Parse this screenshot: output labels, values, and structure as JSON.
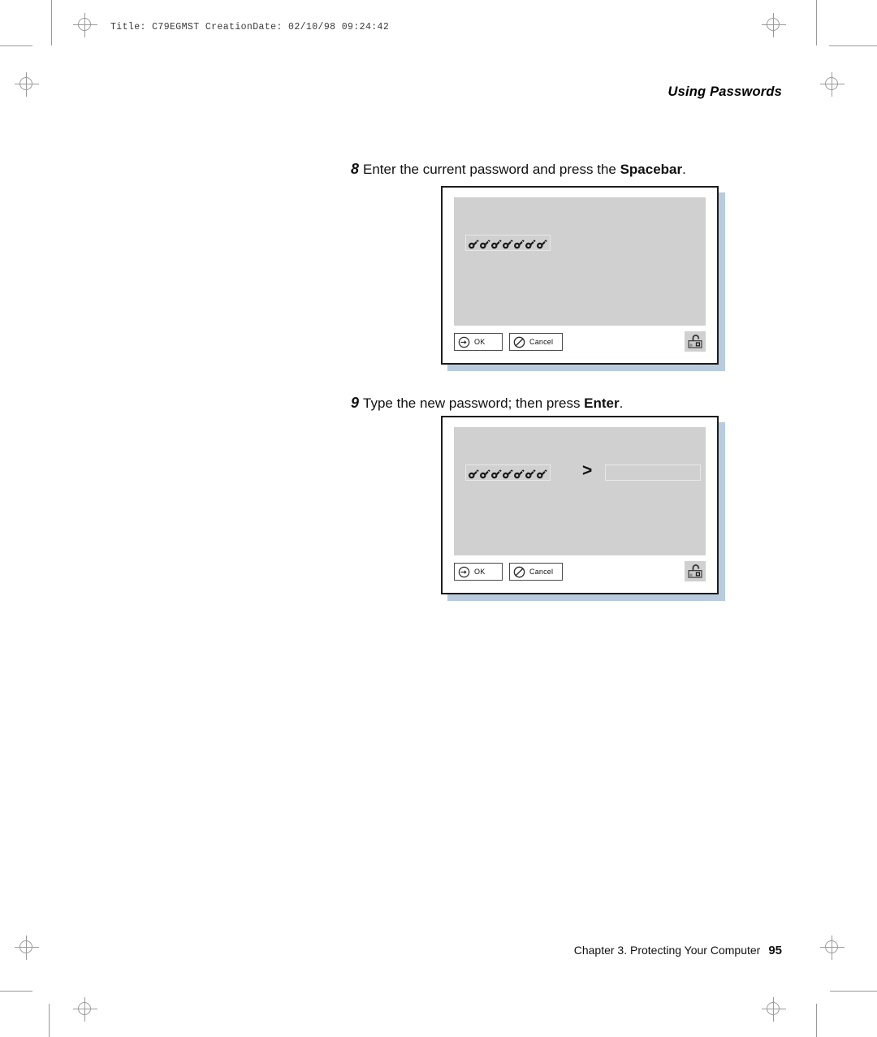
{
  "print_banner": "Title: C79EGMST CreationDate: 02/10/98 09:24:42",
  "page_header": "Using Passwords",
  "steps": [
    {
      "number": "8",
      "text_before": "Enter the current password and press the ",
      "emphasis": "Spacebar",
      "text_after": "."
    },
    {
      "number": "9",
      "text_before": "Type the new password; then press ",
      "emphasis": "Enter",
      "text_after": "."
    }
  ],
  "dialogs": [
    {
      "name": "current-password-dialog",
      "key_count": 7,
      "show_chevron": false,
      "show_entry_field": false,
      "entry_value": "",
      "ok_label": "OK",
      "cancel_label": "Cancel",
      "ok_icon": "arrow-right-circle-icon",
      "cancel_icon": "no-entry-circle-icon",
      "status_icon": "unlocked-padlock-icon"
    },
    {
      "name": "new-password-dialog",
      "key_count": 7,
      "show_chevron": true,
      "chevron": ">",
      "show_entry_field": true,
      "entry_value": "",
      "ok_label": "OK",
      "cancel_label": "Cancel",
      "ok_icon": "arrow-right-circle-icon",
      "cancel_icon": "no-entry-circle-icon",
      "status_icon": "unlocked-padlock-icon"
    }
  ],
  "footer": {
    "chapter": "Chapter 3.  Protecting Your Computer",
    "page_number": "95"
  },
  "colors": {
    "dialog_border": "#1c1c1c",
    "dialog_panel": "#d0d0d0",
    "dialog_shadow": "#b8cbdf",
    "text": "#111111",
    "mark": "#9a9a9a"
  }
}
